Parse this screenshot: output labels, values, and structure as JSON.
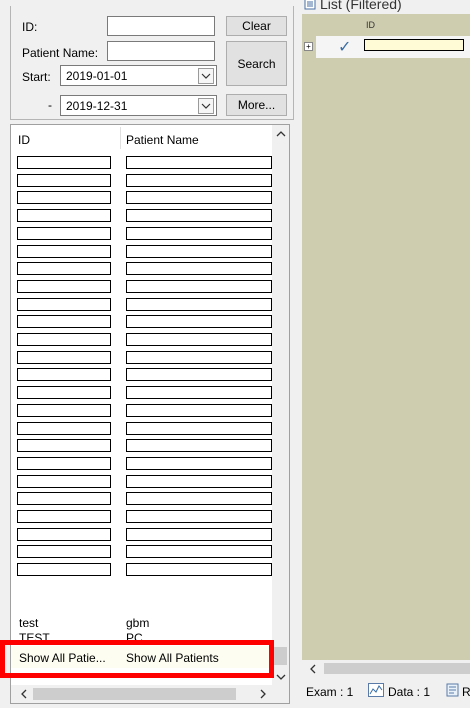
{
  "search": {
    "id_label": "ID:",
    "id_value": "",
    "clear_label": "Clear",
    "patient_name_label": "Patient Name:",
    "patient_name_value": "",
    "search_label": "Search",
    "start_label": "Start:",
    "start_date": "2019-01-01",
    "end_label": "-",
    "end_date": "2019-12-31",
    "more_label": "More..."
  },
  "list": {
    "col_id": "ID",
    "col_patient_name": "Patient Name",
    "masked_row_count": 24,
    "rows": [
      {
        "id": "test",
        "name": "gbm"
      },
      {
        "id": "TEST",
        "name": "PC"
      },
      {
        "id": "Show All Patie...",
        "name": "Show All Patients"
      }
    ]
  },
  "right": {
    "title": "List (Filtered)",
    "col_id": "ID",
    "expand_glyph": "+",
    "check_glyph": "✓",
    "exam_label": "Exam : 1",
    "data_label": "Data : 1",
    "r_label": "R"
  },
  "icons": [
    "chevron-down-icon",
    "chevron-up-icon",
    "chevron-left-icon",
    "chevron-right-icon",
    "list-icon",
    "checkmark-icon",
    "data-icon",
    "document-icon"
  ],
  "colors": {
    "highlight": "#ff0000",
    "masked_field": "#fefbd6",
    "right_background": "#cfcdb0"
  }
}
